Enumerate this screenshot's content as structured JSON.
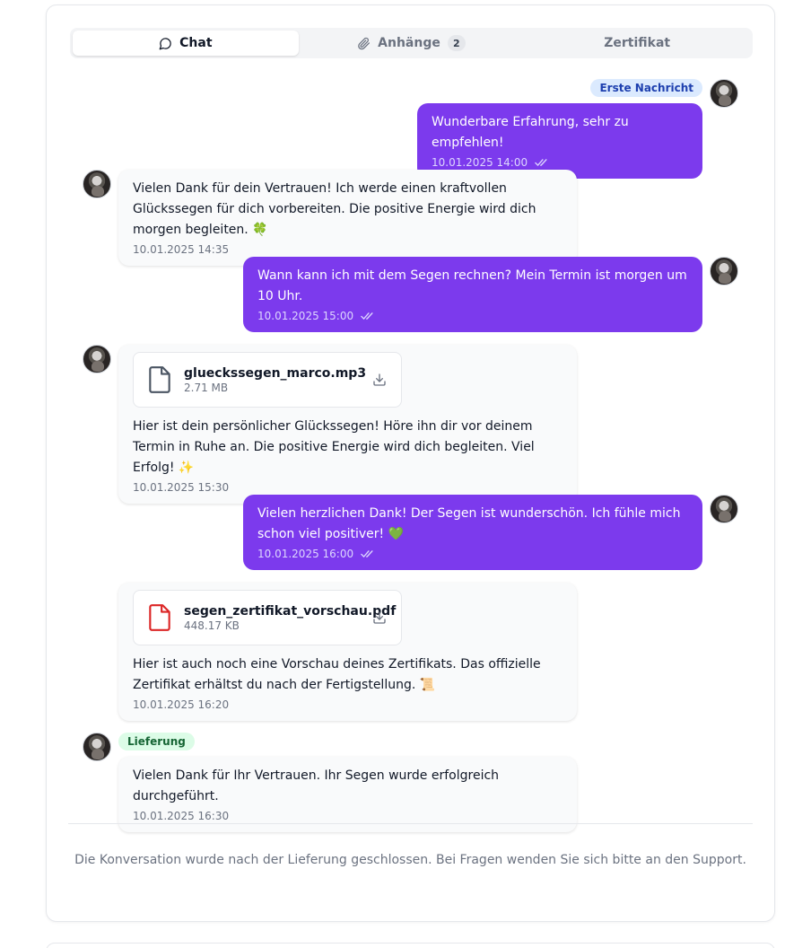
{
  "tabs": [
    {
      "label": "Chat",
      "icon": "chat-bubble-icon",
      "active": true
    },
    {
      "label": "Anhänge",
      "icon": "paperclip-icon",
      "count": "2",
      "active": false
    },
    {
      "label": "Zertifikat",
      "active": false
    }
  ],
  "messages": [
    {
      "direction": "outgoing",
      "badge": "Erste Nachricht",
      "text": "Wunderbare Erfahrung, sehr zu empfehlen!",
      "time": "10.01.2025 14:00",
      "read_icon": "double-check-icon"
    },
    {
      "direction": "incoming",
      "text": "Vielen Dank für dein Vertrauen! Ich werde einen kraftvollen Glückssegen für dich vorbereiten. Die positive Energie wird dich morgen begleiten. 🍀",
      "time": "10.01.2025 14:35"
    },
    {
      "direction": "outgoing",
      "text": "Wann kann ich mit dem Segen rechnen? Mein Termin ist morgen um 10 Uhr.",
      "time": "10.01.2025 15:00",
      "read_icon": "double-check-icon"
    },
    {
      "direction": "incoming",
      "attachment": {
        "name": "glueckssegen_marco.mp3",
        "size": "2.71 MB",
        "icon": "file-icon"
      },
      "text": "Hier ist dein persönlicher Glückssegen! Höre ihn dir vor deinem Termin in Ruhe an. Die positive Energie wird dich begleiten. Viel Erfolg! ✨",
      "time": "10.01.2025 15:30"
    },
    {
      "direction": "outgoing",
      "text": "Vielen herzlichen Dank! Der Segen ist wunderschön. Ich fühle mich schon viel positiver! 💚",
      "time": "10.01.2025 16:00",
      "read_icon": "double-check-icon"
    },
    {
      "direction": "incoming",
      "attachment": {
        "name": "segen_zertifikat_vorschau.pdf",
        "size": "448.17 KB",
        "icon": "pdf-file-icon"
      },
      "text": "Hier ist auch noch eine Vorschau deines Zertifikats. Das offizielle Zertifikat erhältst du nach der Fertigstellung. 📜",
      "time": "10.01.2025 16:20"
    },
    {
      "direction": "incoming",
      "badge": "Lieferung",
      "text": "Vielen Dank für Ihr Vertrauen. Ihr Segen wurde erfolgreich durchgeführt.",
      "time": "10.01.2025 16:30"
    }
  ],
  "closed_note": "Die Konversation wurde nach der Lieferung geschlossen. Bei Fragen wenden Sie sich bitte an den Support.",
  "colors": {
    "outgoing_bubble": "#7c3aed",
    "incoming_bubble": "#f9fafb",
    "badge_blue": "#dbeafe",
    "badge_green": "#dcfce7",
    "pdf_icon": "#dc2626"
  }
}
